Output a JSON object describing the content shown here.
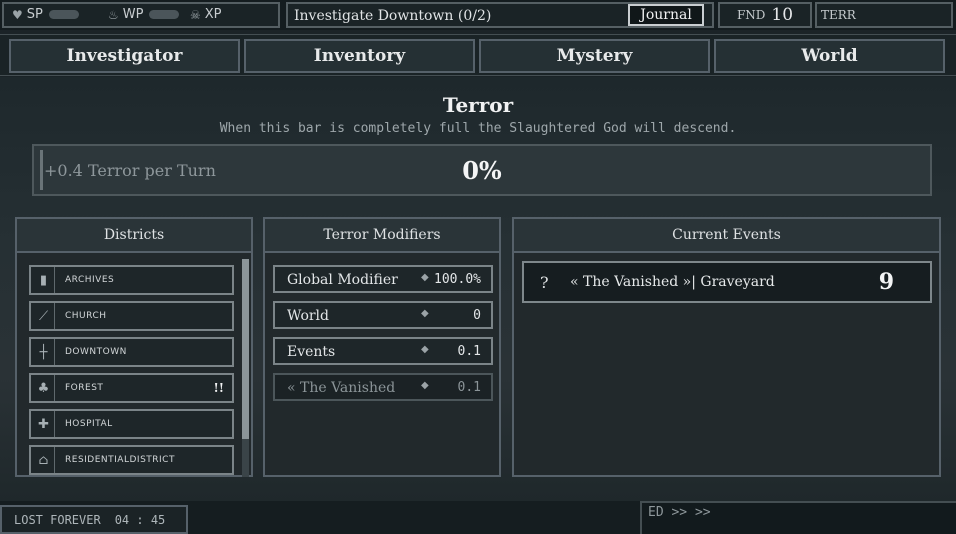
{
  "topbar": {
    "stats": [
      {
        "icon": "heart-icon",
        "label": "SP"
      },
      {
        "icon": "flame-icon",
        "label": "WP"
      },
      {
        "icon": "skull-icon",
        "label": "XP"
      }
    ],
    "quest": "Investigate Downtown (0/2)",
    "journal_label": "Journal",
    "fnd_label": "FND",
    "fnd_value": "10",
    "terr_label": "TERR"
  },
  "nav": {
    "tabs": [
      "Investigator",
      "Inventory",
      "Mystery",
      "World"
    ]
  },
  "terror": {
    "title": "Terror",
    "subtitle": "When this bar is completely full the Slaughtered God will descend.",
    "rate": "+0.4 Terror per Turn",
    "percent_label": "0%",
    "fill_fraction": 0,
    "fill_color": "#6b2a2a"
  },
  "districts": {
    "title": "Districts",
    "items": [
      {
        "name": "ARCHIVES",
        "icon": "book-icon",
        "alert": ""
      },
      {
        "name": "CHURCH",
        "icon": "bell-icon",
        "alert": ""
      },
      {
        "name": "DOWNTOWN",
        "icon": "crossroads-icon",
        "alert": ""
      },
      {
        "name": "FOREST",
        "icon": "tree-icon",
        "alert": "!!"
      },
      {
        "name": "HOSPITAL",
        "icon": "cross-icon",
        "alert": ""
      },
      {
        "name": "RESIDENTIALDISTRICT",
        "icon": "house-icon",
        "alert": ""
      }
    ]
  },
  "modifiers": {
    "title": "Terror Modifiers",
    "items": [
      {
        "name": "Global Modifier",
        "value": "100.0%",
        "dim": false
      },
      {
        "name": "World",
        "value": "0",
        "dim": false
      },
      {
        "name": "Events",
        "value": "0.1",
        "dim": false
      },
      {
        "name": "« The Vanished",
        "value": "0.1",
        "dim": true
      }
    ]
  },
  "events": {
    "title": "Current Events",
    "items": [
      {
        "marker": "?",
        "name": "« The Vanished »| Graveyard",
        "turns": "9"
      }
    ]
  },
  "bottombar": {
    "status": "LOST FOREVER",
    "time": "04 : 45",
    "log": "ED >> >>"
  },
  "colors": {
    "background": "#1b2327",
    "panel": "#22292c",
    "border": "#56616a",
    "text": "#d9dde0"
  }
}
